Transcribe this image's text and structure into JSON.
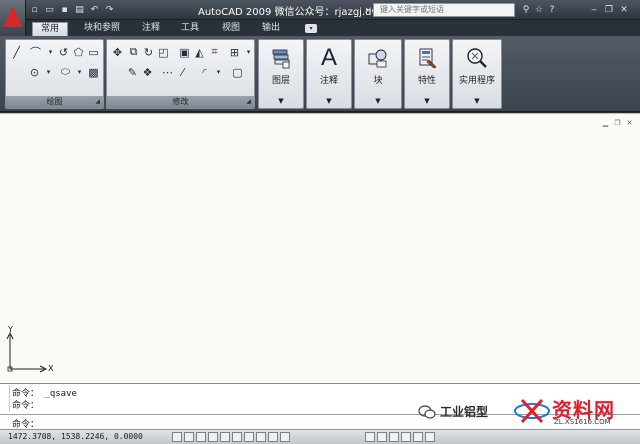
{
  "app": {
    "window_title": "AutoCAD 2009  微信公众号：rjazgj.dwg",
    "search_placeholder": "键入关键字或短语"
  },
  "tabs": [
    "常用",
    "块和参照",
    "注释",
    "工具",
    "视图",
    "输出"
  ],
  "panels": {
    "draw_label": "绘图",
    "modify_label": "修改",
    "big": [
      {
        "label": "图层",
        "icon": "layers-icon"
      },
      {
        "label": "注释",
        "icon": "annotation-icon"
      },
      {
        "label": "块",
        "icon": "block-icon"
      },
      {
        "label": "特性",
        "icon": "properties-icon"
      },
      {
        "label": "实用程序",
        "icon": "utilities-icon"
      }
    ]
  },
  "drawing": {
    "ucs_y": "Y",
    "ucs_x": "X"
  },
  "command": {
    "history": [
      "命令：  _qsave",
      "命令："
    ],
    "prompt": "命令："
  },
  "status": {
    "coords": "1472.3708,  1538.2246,  0.0000"
  },
  "watermark": {
    "text": "工业铝型",
    "logo_main": "资料网",
    "logo_sub": "ZL.XS1616.COM"
  },
  "colors": {
    "autocad_red": "#d8272b",
    "canvas": "#fbfaf6",
    "ribbon_dark": "#3d444d",
    "watermark_red": "#e01f2c"
  }
}
